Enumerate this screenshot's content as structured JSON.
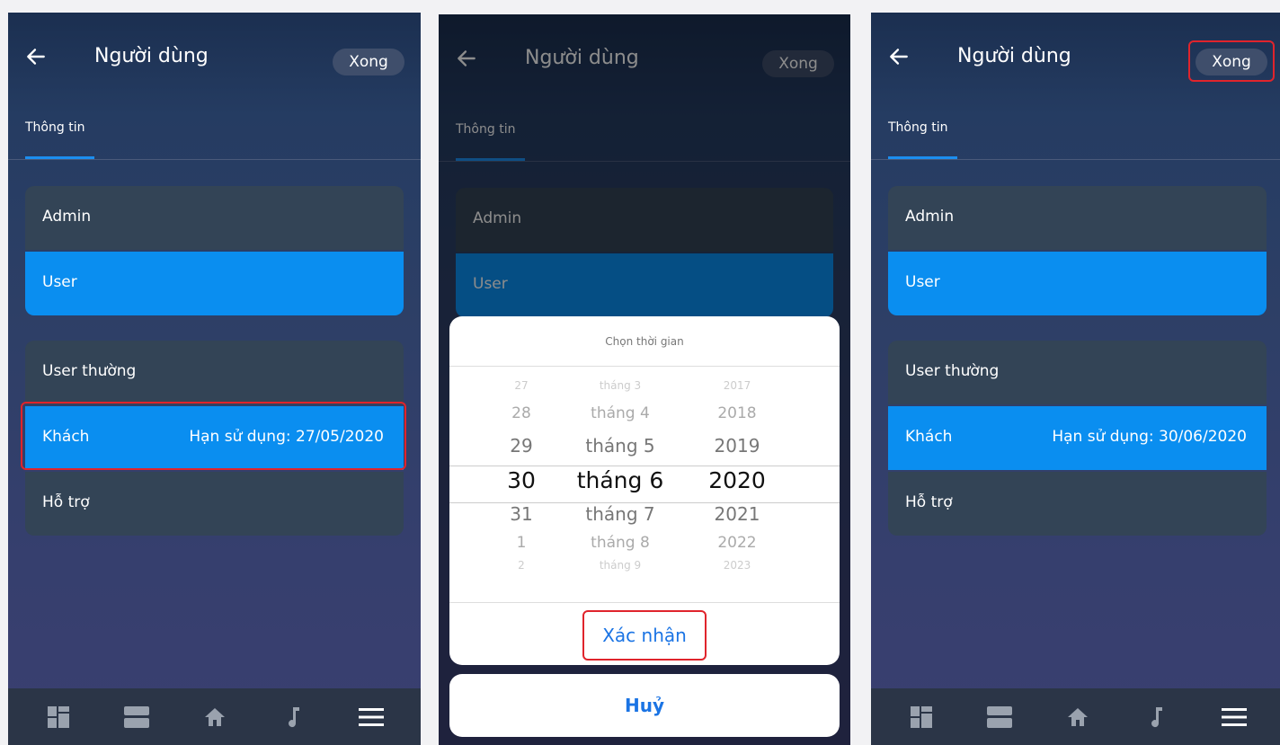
{
  "screens": [
    {
      "header": {
        "title": "Người dùng",
        "done_label": "Xong"
      },
      "tab": "Thông tin",
      "roles": [
        {
          "label": "Admin"
        },
        {
          "label": "User"
        }
      ],
      "users": [
        {
          "label": "User thường",
          "value": ""
        },
        {
          "label": "Khách",
          "value": "Hạn sử dụng: 27/05/2020"
        },
        {
          "label": "Hỗ trợ",
          "value": ""
        }
      ]
    },
    {
      "header": {
        "title": "Người dùng",
        "done_label": "Xong"
      },
      "tab": "Thông tin",
      "roles": [
        {
          "label": "Admin"
        },
        {
          "label": "User"
        }
      ],
      "picker": {
        "title": "Chọn thời gian",
        "days": [
          "27",
          "28",
          "29",
          "30",
          "31",
          "1",
          "2"
        ],
        "months": [
          "tháng 3",
          "tháng 4",
          "tháng 5",
          "tháng 6",
          "tháng 7",
          "tháng 8",
          "tháng 9"
        ],
        "years": [
          "2017",
          "2018",
          "2019",
          "2020",
          "2021",
          "2022",
          "2023"
        ],
        "confirm_label": "Xác nhận",
        "cancel_label": "Huỷ"
      }
    },
    {
      "header": {
        "title": "Người dùng",
        "done_label": "Xong"
      },
      "tab": "Thông tin",
      "roles": [
        {
          "label": "Admin"
        },
        {
          "label": "User"
        }
      ],
      "users": [
        {
          "label": "User thường",
          "value": ""
        },
        {
          "label": "Khách",
          "value": "Hạn sử dụng: 30/06/2020"
        },
        {
          "label": "Hỗ trợ",
          "value": ""
        }
      ]
    }
  ],
  "icons": [
    "back-arrow-icon",
    "dashboard-icon",
    "rooms-icon",
    "home-icon",
    "music-icon",
    "menu-icon"
  ],
  "colors": {
    "accent": "#0a8ef0",
    "highlight": "#e0242c",
    "link": "#1b74e4"
  }
}
